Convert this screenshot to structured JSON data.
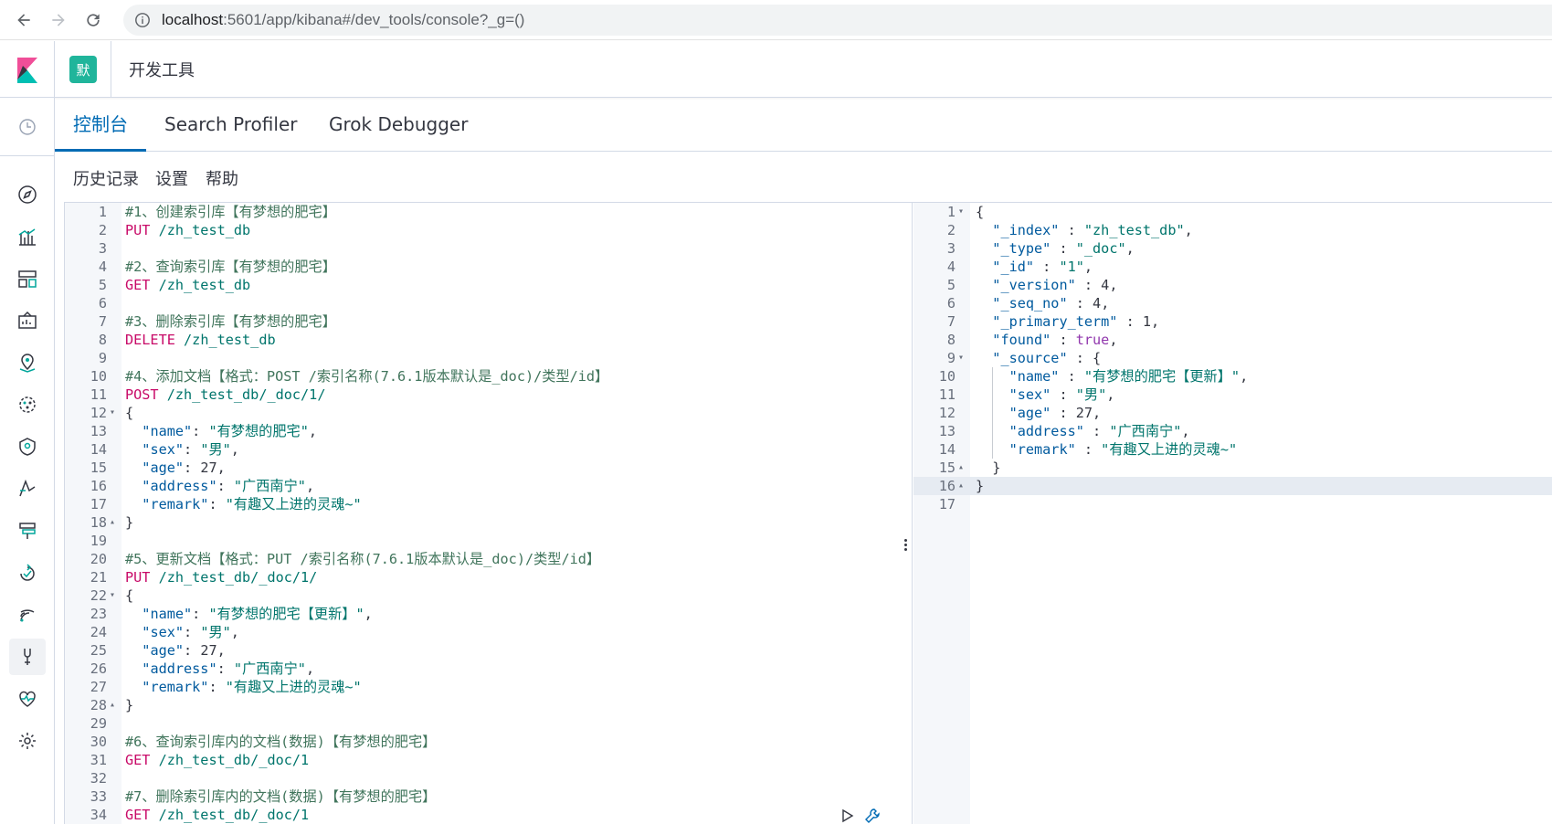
{
  "browser": {
    "url_host": "localhost",
    "url_rest": ":5601/app/kibana#/dev_tools/console?_g=()"
  },
  "header": {
    "space_initial": "默",
    "breadcrumb": "开发工具"
  },
  "tabs": [
    {
      "label": "控制台",
      "active": true
    },
    {
      "label": "Search Profiler",
      "active": false
    },
    {
      "label": "Grok Debugger",
      "active": false
    }
  ],
  "toolbar": {
    "history": "历史记录",
    "settings": "设置",
    "help": "帮助"
  },
  "request_editor": {
    "lines": [
      {
        "n": "1",
        "text": "#1、创建索引库【有梦想的肥宅】"
      },
      {
        "n": "2",
        "text": "PUT /zh_test_db"
      },
      {
        "n": "3",
        "text": ""
      },
      {
        "n": "4",
        "text": "#2、查询索引库【有梦想的肥宅】"
      },
      {
        "n": "5",
        "text": "GET /zh_test_db"
      },
      {
        "n": "6",
        "text": ""
      },
      {
        "n": "7",
        "text": "#3、删除索引库【有梦想的肥宅】"
      },
      {
        "n": "8",
        "text": "DELETE /zh_test_db"
      },
      {
        "n": "9",
        "text": ""
      },
      {
        "n": "10",
        "text": "#4、添加文档【格式：POST /索引名称(7.6.1版本默认是_doc)/类型/id】"
      },
      {
        "n": "11",
        "text": "POST /zh_test_db/_doc/1/"
      },
      {
        "n": "12",
        "text": "{"
      },
      {
        "n": "13",
        "text": "  \"name\": \"有梦想的肥宅\","
      },
      {
        "n": "14",
        "text": "  \"sex\": \"男\","
      },
      {
        "n": "15",
        "text": "  \"age\": 27,"
      },
      {
        "n": "16",
        "text": "  \"address\": \"广西南宁\","
      },
      {
        "n": "17",
        "text": "  \"remark\": \"有趣又上进的灵魂~\""
      },
      {
        "n": "18",
        "text": "}"
      },
      {
        "n": "19",
        "text": ""
      },
      {
        "n": "20",
        "text": "#5、更新文档【格式：PUT /索引名称(7.6.1版本默认是_doc)/类型/id】"
      },
      {
        "n": "21",
        "text": "PUT /zh_test_db/_doc/1/"
      },
      {
        "n": "22",
        "text": "{"
      },
      {
        "n": "23",
        "text": "  \"name\": \"有梦想的肥宅【更新】\","
      },
      {
        "n": "24",
        "text": "  \"sex\": \"男\","
      },
      {
        "n": "25",
        "text": "  \"age\": 27,"
      },
      {
        "n": "26",
        "text": "  \"address\": \"广西南宁\","
      },
      {
        "n": "27",
        "text": "  \"remark\": \"有趣又上进的灵魂~\""
      },
      {
        "n": "28",
        "text": "}"
      },
      {
        "n": "29",
        "text": ""
      },
      {
        "n": "30",
        "text": "#6、查询索引库内的文档(数据)【有梦想的肥宅】"
      },
      {
        "n": "31",
        "text": "GET /zh_test_db/_doc/1"
      },
      {
        "n": "32",
        "text": ""
      },
      {
        "n": "33",
        "text": "#7、删除索引库内的文档(数据)【有梦想的肥宅】"
      },
      {
        "n": "34",
        "text": "GET /zh_test_db/_doc/1"
      }
    ]
  },
  "response_editor": {
    "lines": [
      {
        "n": "1",
        "text": "{"
      },
      {
        "n": "2",
        "text": "  \"_index\" : \"zh_test_db\","
      },
      {
        "n": "3",
        "text": "  \"_type\" : \"_doc\","
      },
      {
        "n": "4",
        "text": "  \"_id\" : \"1\","
      },
      {
        "n": "5",
        "text": "  \"_version\" : 4,"
      },
      {
        "n": "6",
        "text": "  \"_seq_no\" : 4,"
      },
      {
        "n": "7",
        "text": "  \"_primary_term\" : 1,"
      },
      {
        "n": "8",
        "text": "  \"found\" : true,"
      },
      {
        "n": "9",
        "text": "  \"_source\" : {"
      },
      {
        "n": "10",
        "text": "    \"name\" : \"有梦想的肥宅【更新】\","
      },
      {
        "n": "11",
        "text": "    \"sex\" : \"男\","
      },
      {
        "n": "12",
        "text": "    \"age\" : 27,"
      },
      {
        "n": "13",
        "text": "    \"address\" : \"广西南宁\","
      },
      {
        "n": "14",
        "text": "    \"remark\" : \"有趣又上进的灵魂~\""
      },
      {
        "n": "15",
        "text": "  }"
      },
      {
        "n": "16",
        "text": "}"
      },
      {
        "n": "17",
        "text": ""
      }
    ]
  },
  "colors": {
    "accent": "#006bb4",
    "space_badge": "#20b59b",
    "method": "#c80a68",
    "string": "#00756c",
    "key": "#005a9e",
    "comment": "#41755c",
    "bool": "#9137ad"
  },
  "nav_icons": [
    "clock-icon",
    "compass-icon",
    "visualize-icon",
    "dashboard-icon",
    "canvas-icon",
    "maps-icon",
    "ml-icon",
    "siem-icon",
    "apm-icon",
    "uptime-icon",
    "dev-tools-icon",
    "monitoring-icon",
    "settings-icon"
  ]
}
